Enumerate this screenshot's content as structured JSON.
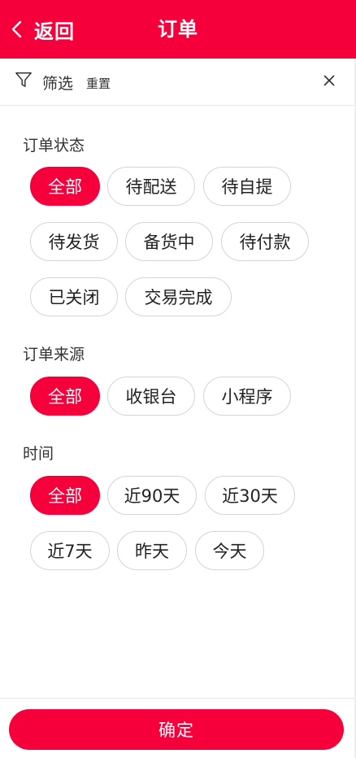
{
  "header": {
    "back_label": "返回",
    "title": "订单"
  },
  "filterbar": {
    "label": "筛选",
    "reset_label": "重置"
  },
  "sections": {
    "status": {
      "title": "订单状态",
      "options": [
        "全部",
        "待配送",
        "待自提",
        "待发货",
        "备货中",
        "待付款",
        "已关闭",
        "交易完成"
      ],
      "selected": "全部"
    },
    "source": {
      "title": "订单来源",
      "options": [
        "全部",
        "收银台",
        "小程序"
      ],
      "selected": "全部"
    },
    "time": {
      "title": "时间",
      "options": [
        "全部",
        "近90天",
        "近30天",
        "近7天",
        "昨天",
        "今天"
      ],
      "selected": "全部"
    }
  },
  "footer": {
    "confirm_label": "确定"
  },
  "colors": {
    "accent": "#f5003a",
    "chip_border": "#d4d4d4"
  },
  "icons": [
    "chevron-left-icon",
    "filter-icon",
    "close-icon"
  ]
}
